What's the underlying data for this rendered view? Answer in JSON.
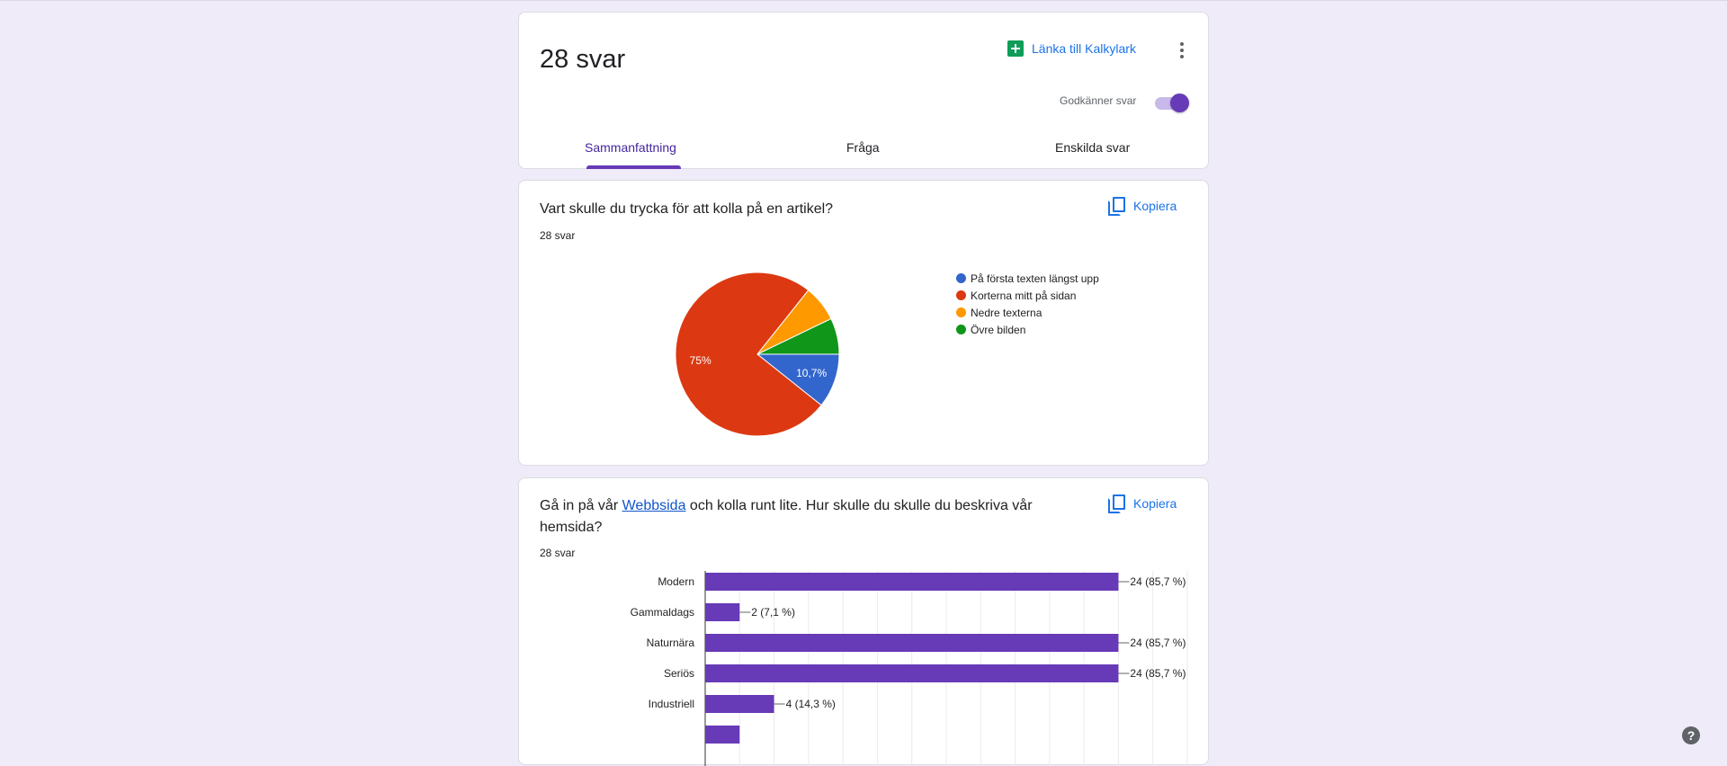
{
  "header": {
    "responses_title": "28 svar",
    "link_sheet_label": "Länka till Kalkylark",
    "accepting_label": "Godkänner svar",
    "accepting": true,
    "tabs": [
      {
        "label": "Sammanfattning",
        "active": true
      },
      {
        "label": "Fråga",
        "active": false
      },
      {
        "label": "Enskilda svar",
        "active": false
      }
    ]
  },
  "questions": [
    {
      "title": "Vart skulle du trycka för att kolla på en artikel?",
      "count": "28 svar",
      "copy_label": "Kopiera"
    },
    {
      "title_before": "Gå in på vår ",
      "title_link": "Webbsida",
      "title_after": " och kolla runt lite. Hur skulle du skulle du beskriva vår hemsida?",
      "count": "28 svar",
      "copy_label": "Kopiera"
    }
  ],
  "chart_data": [
    {
      "type": "pie",
      "series": [
        {
          "name": "På första texten längst upp",
          "value": 3,
          "label": "10,7%",
          "color": "#3366cc"
        },
        {
          "name": "Korterna mitt på sidan",
          "value": 21,
          "label": "75%",
          "color": "#dc3912"
        },
        {
          "name": "Nedre texterna",
          "value": 2,
          "label": "",
          "color": "#ff9900"
        },
        {
          "name": "Övre bilden",
          "value": 2,
          "label": "",
          "color": "#109618"
        }
      ],
      "legend_position": "right"
    },
    {
      "type": "bar",
      "orientation": "horizontal",
      "color": "#673ab7",
      "categories": [
        "Modern",
        "Gammaldags",
        "Naturnära",
        "Seriös",
        "Industriell"
      ],
      "values": [
        24,
        2,
        24,
        24,
        4
      ],
      "data_labels": [
        "24 (85,7 %)",
        "2 (7,1 %)",
        "24 (85,7 %)",
        "24 (85,7 %)",
        "4 (14,3 %)"
      ],
      "xlim": [
        0,
        28
      ],
      "grid": true
    }
  ],
  "help_label": "?"
}
